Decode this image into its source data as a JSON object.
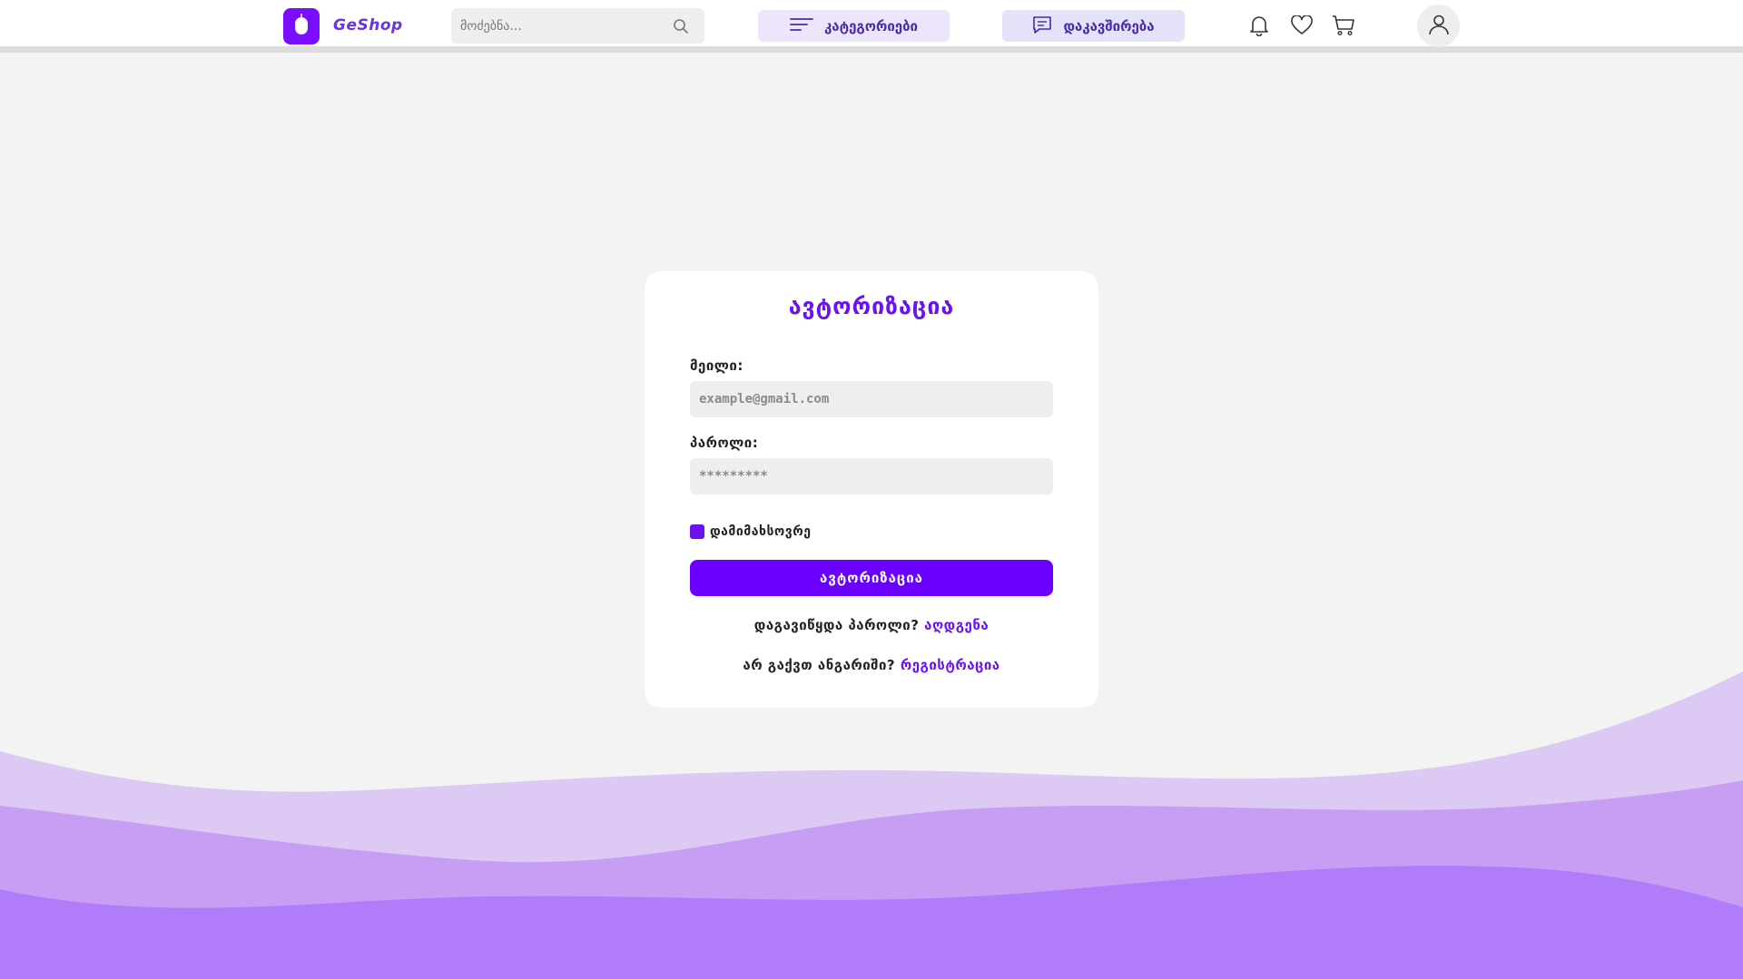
{
  "header": {
    "brand": "GeShop",
    "search_placeholder": "მოძებნა...",
    "categories_label": "კატეგორიები",
    "contact_label": "დაკავშირება"
  },
  "login": {
    "title": "ავტორიზაცია",
    "email_label": "მეილი:",
    "email_placeholder": "example@gmail.com",
    "password_label": "პაროლი:",
    "password_placeholder": "*********",
    "remember_label": "დამიმახსოვრე",
    "remember_checked": true,
    "submit_label": "ავტორიზაცია",
    "forgot_text": "დაგავიწყდა პაროლი?",
    "forgot_link": "აღდგენა",
    "register_text": "არ გაქვთ ანგარიში?",
    "register_link": "რეგისტრაცია"
  },
  "icons": {
    "search": "search-icon",
    "menu": "menu-lines-icon",
    "chat": "chat-icon",
    "bell": "bell-icon",
    "heart": "heart-icon",
    "cart": "cart-icon",
    "user": "user-icon",
    "logo": "mouse-icon"
  },
  "colors": {
    "accent": "#6a00ff",
    "brand_text": "#6a34e0",
    "wave_light": "#d8c4f3",
    "wave_mid": "#c49cf3",
    "wave_dark": "#b07cf8",
    "background": "#f3f3f3"
  }
}
